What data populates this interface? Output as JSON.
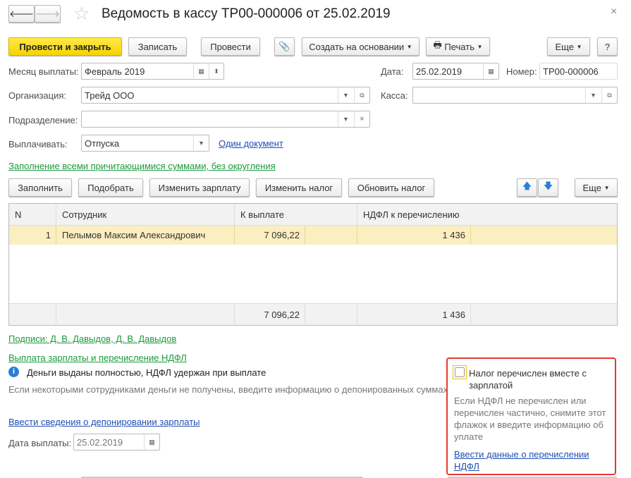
{
  "window": {
    "title": "Ведомость в кассу ТР00-000006 от 25.02.2019",
    "close": "×"
  },
  "toolbar": {
    "post_close": "Провести и закрыть",
    "save": "Записать",
    "post": "Провести",
    "create_based": "Создать на основании",
    "print": "Печать",
    "more": "Еще",
    "help": "?"
  },
  "form": {
    "month_label": "Месяц выплаты:",
    "month_value": "Февраль 2019",
    "date_label": "Дата:",
    "date_value": "25.02.2019",
    "number_label": "Номер:",
    "number_value": "ТР00-000006",
    "org_label": "Организация:",
    "org_value": "Трейд ООО",
    "cash_label": "Касса:",
    "cash_value": "",
    "dept_label": "Подразделение:",
    "dept_value": "",
    "pay_label": "Выплачивать:",
    "pay_value": "Отпуска",
    "one_doc_link": "Один документ",
    "fill_link": "Заполнение всеми причитающимися суммами, без округления"
  },
  "table_toolbar": {
    "fill": "Заполнить",
    "pick": "Подобрать",
    "change_salary": "Изменить зарплату",
    "change_tax": "Изменить налог",
    "update_tax": "Обновить налог",
    "more": "Еще"
  },
  "table": {
    "headers": [
      "N",
      "Сотрудник",
      "К выплате",
      "НДФЛ к перечислению"
    ],
    "rows": [
      {
        "n": "1",
        "employee": "Пелымов Максим Александрович",
        "pay": "7 096,22",
        "tax": "1 436"
      }
    ],
    "totals": {
      "pay": "7 096,22",
      "tax": "1 436"
    }
  },
  "signatures_link": "Подписи: Д. В. Давыдов, Д. В. Давыдов",
  "payment_section_link": "Выплата зарплаты и перечисление НДФЛ",
  "info_text": "Деньги выданы полностью, НДФЛ удержан при выплате",
  "hint_text": "Если некоторыми сотрудниками деньги не получены, введите информацию о депонированных суммах",
  "deposit_link": "Ввести сведения о депонировании зарплаты",
  "pay_date_label": "Дата выплаты:",
  "pay_date_value": "25.02.2019",
  "tax_panel": {
    "checkbox_label": "Налог перечислен вместе с зарплатой",
    "checked": false,
    "hint": "Если НДФЛ не перечислен или перечислен частично, снимите этот флажок и введите информацию об уплате",
    "link": "Ввести данные о перечислении НДФЛ",
    "highlight_color": "#e53935"
  }
}
